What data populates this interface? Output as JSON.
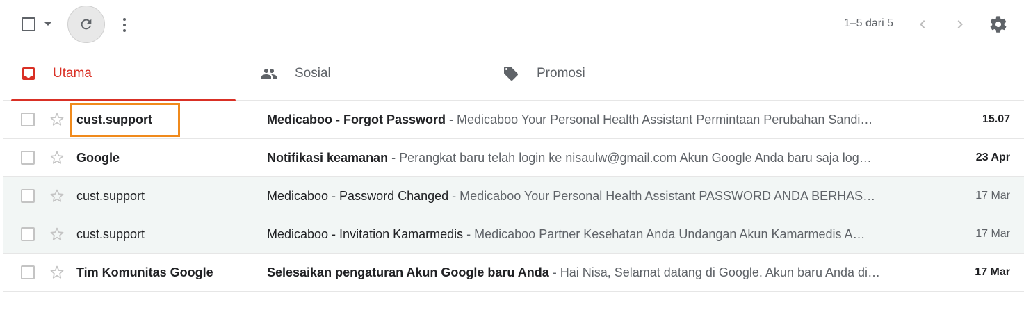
{
  "toolbar": {
    "select_icon": "checkbox-icon",
    "caret_icon": "caret-down-icon",
    "refresh_icon": "refresh-icon",
    "more_icon": "more-vert-icon",
    "range": "1–5 dari 5",
    "prev_icon": "chevron-left-icon",
    "next_icon": "chevron-right-icon",
    "settings_icon": "gear-icon"
  },
  "tabs": [
    {
      "label": "Utama",
      "icon": "inbox-icon",
      "active": true
    },
    {
      "label": "Sosial",
      "icon": "people-icon",
      "active": false
    },
    {
      "label": "Promosi",
      "icon": "tag-icon",
      "active": false
    }
  ],
  "messages": [
    {
      "sender": "cust.support",
      "subject": "Medicaboo - Forgot Password",
      "snippet": " - Medicaboo Your Personal Health Assistant Permintaan Perubahan Sandi…",
      "date": "15.07",
      "unread": true,
      "highlighted": true
    },
    {
      "sender": "Google",
      "subject": "Notifikasi keamanan",
      "snippet": " - Perangkat baru telah login ke nisaulw@gmail.com Akun Google Anda baru saja log…",
      "date": "23 Apr",
      "unread": true,
      "highlighted": false
    },
    {
      "sender": "cust.support",
      "subject": "Medicaboo - Password Changed",
      "snippet": " - Medicaboo Your Personal Health Assistant PASSWORD ANDA BERHAS…",
      "date": "17 Mar",
      "unread": false,
      "highlighted": false
    },
    {
      "sender": "cust.support",
      "subject": "Medicaboo - Invitation Kamarmedis",
      "snippet": " - Medicaboo Partner Kesehatan Anda Undangan Akun Kamarmedis A…",
      "date": "17 Mar",
      "unread": false,
      "highlighted": false
    },
    {
      "sender": "Tim Komunitas Google",
      "subject": "Selesaikan pengaturan Akun Google baru Anda",
      "snippet": " - Hai Nisa, Selamat datang di Google. Akun baru Anda di…",
      "date": "17 Mar",
      "unread": true,
      "highlighted": false
    }
  ],
  "colors": {
    "accent": "#d93025",
    "highlight": "#f08a1c",
    "read_row_bg": "#f2f6f5"
  }
}
